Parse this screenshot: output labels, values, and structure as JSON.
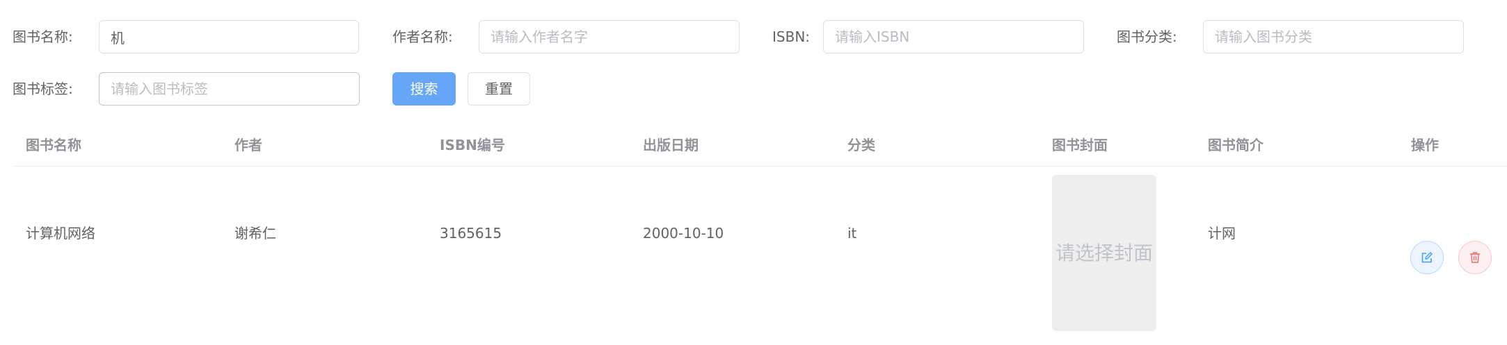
{
  "filters": {
    "book_name": {
      "label": "图书名称:",
      "value": "机",
      "placeholder": ""
    },
    "author_name": {
      "label": "作者名称:",
      "value": "",
      "placeholder": "请输入作者名字"
    },
    "isbn": {
      "label": "ISBN:",
      "value": "",
      "placeholder": "请输入ISBN"
    },
    "category": {
      "label": "图书分类:",
      "value": "",
      "placeholder": "请输入图书分类"
    },
    "tag": {
      "label": "图书标签:",
      "value": "",
      "placeholder": "请输入图书标签"
    },
    "search_label": "搜索",
    "reset_label": "重置"
  },
  "table": {
    "columns": [
      "图书名称",
      "作者",
      "ISBN编号",
      "出版日期",
      "分类",
      "图书封面",
      "图书简介",
      "操作"
    ],
    "rows": [
      {
        "name": "计算机网络",
        "author": "谢希仁",
        "isbn": "3165615",
        "publish_date": "2000-10-10",
        "category": "it",
        "cover_placeholder": "请选择封面",
        "intro": "计网",
        "edit_icon": "edit-icon",
        "delete_icon": "trash-icon"
      }
    ]
  },
  "colors": {
    "primary": "#66a6f7",
    "edit": "#409eff",
    "delete": "#f56c6c"
  }
}
